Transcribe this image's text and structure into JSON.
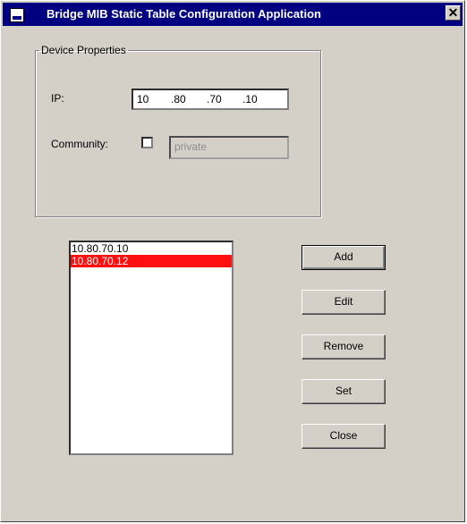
{
  "window": {
    "title": "Bridge MIB Static Table Configuration Application",
    "close_symbol": "✕"
  },
  "device_properties": {
    "legend": "Device Properties",
    "ip_label": "IP:",
    "ip_octets": [
      "10",
      ".80",
      ".70",
      ".10"
    ],
    "community_label": "Community:",
    "community_checked": false,
    "community_value": "private"
  },
  "list": {
    "items": [
      "10.80.70.10",
      "10.80.70.12"
    ],
    "selected_index": 1
  },
  "buttons": {
    "add": "Add",
    "edit": "Edit",
    "remove": "Remove",
    "set": "Set",
    "close": "Close"
  },
  "colors": {
    "titlebar": "#000080",
    "selection": "#ff1010",
    "face": "#d4d0c8"
  }
}
